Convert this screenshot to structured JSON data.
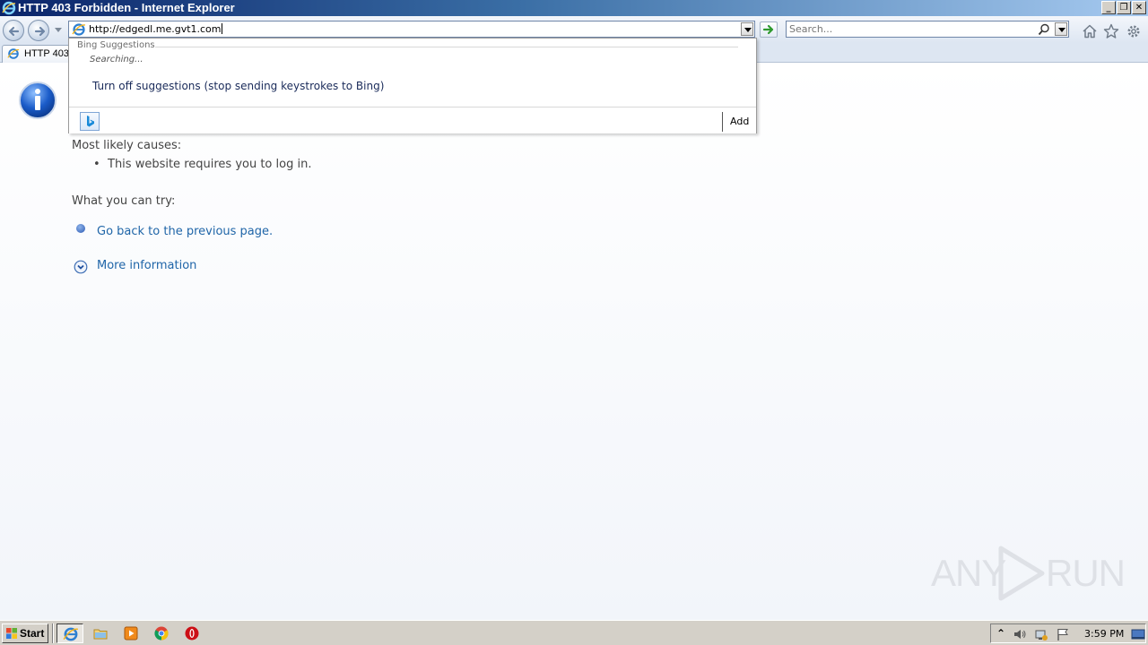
{
  "window": {
    "title": "HTTP 403 Forbidden - Internet Explorer",
    "minimize_glyph": "_",
    "restore_glyph": "❐",
    "close_glyph": "✕"
  },
  "navbar": {
    "back_icon": "back-arrow-icon",
    "forward_icon": "forward-arrow-icon",
    "address_value": "http://edgedl.me.gvt1.com",
    "search_placeholder": "Search...",
    "toolbar_icons": [
      "home-icon",
      "favorites-star-icon",
      "tools-gear-icon"
    ]
  },
  "tabs": [
    {
      "label": "HTTP 403"
    }
  ],
  "suggestions": {
    "header": "Bing Suggestions",
    "status": "Searching...",
    "turn_off": "Turn off suggestions (stop sending keystrokes to Bing)",
    "add_label": "Add"
  },
  "page": {
    "causes_heading": "Most likely causes:",
    "bullet_glyph": "•",
    "causes": [
      "This website requires you to log in."
    ],
    "try_heading": "What you can try:",
    "back_link": "Go back to the previous page.",
    "more_info_link": "More information"
  },
  "taskbar": {
    "start_label": "Start",
    "apps": [
      "internet-explorer",
      "file-explorer",
      "media-player",
      "chrome",
      "opera"
    ],
    "active_app": "internet-explorer",
    "clock": "3:59 PM",
    "tray_glyph": "⌃"
  },
  "watermark": {
    "left": "ANY",
    "right": "RUN"
  },
  "colors": {
    "link": "#1f65a8",
    "titlebar_start": "#0a246a",
    "info_blue": "#1b5cc9"
  }
}
